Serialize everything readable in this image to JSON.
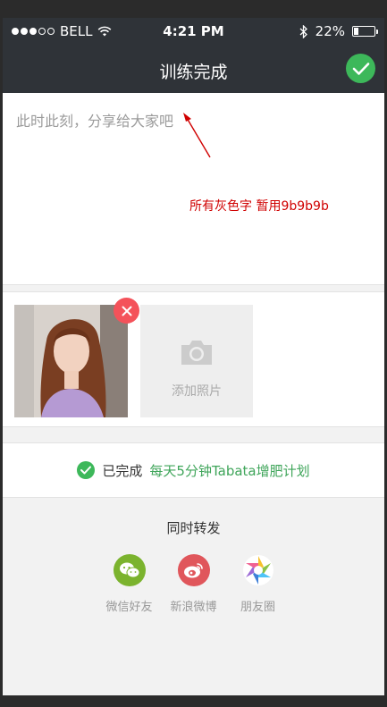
{
  "status_bar": {
    "carrier": "BELL",
    "time": "4:21 PM",
    "battery": "22%",
    "battery_level": 0.22
  },
  "nav": {
    "title": "训练完成",
    "done_icon": "check-icon"
  },
  "compose": {
    "placeholder": "此时此刻，分享给大家吧",
    "annotation": "所有灰色字 暂用9b9b9b"
  },
  "photos": {
    "add_label": "添加照片"
  },
  "completed": {
    "label": "已完成",
    "plan": "每天5分钟Tabata增肥计划"
  },
  "share": {
    "title": "同时转发",
    "items": [
      {
        "label": "微信好友",
        "icon": "wechat-icon",
        "color": "#7bb32e"
      },
      {
        "label": "新浪微博",
        "icon": "weibo-icon",
        "color": "#e0565b"
      },
      {
        "label": "朋友圈",
        "icon": "moments-icon",
        "color": "#ffffff"
      }
    ]
  },
  "colors": {
    "accent_green": "#3db85a",
    "gray_text": "#9b9b9b",
    "dark_bar": "#2f3338",
    "remove_red": "#f4525a"
  }
}
